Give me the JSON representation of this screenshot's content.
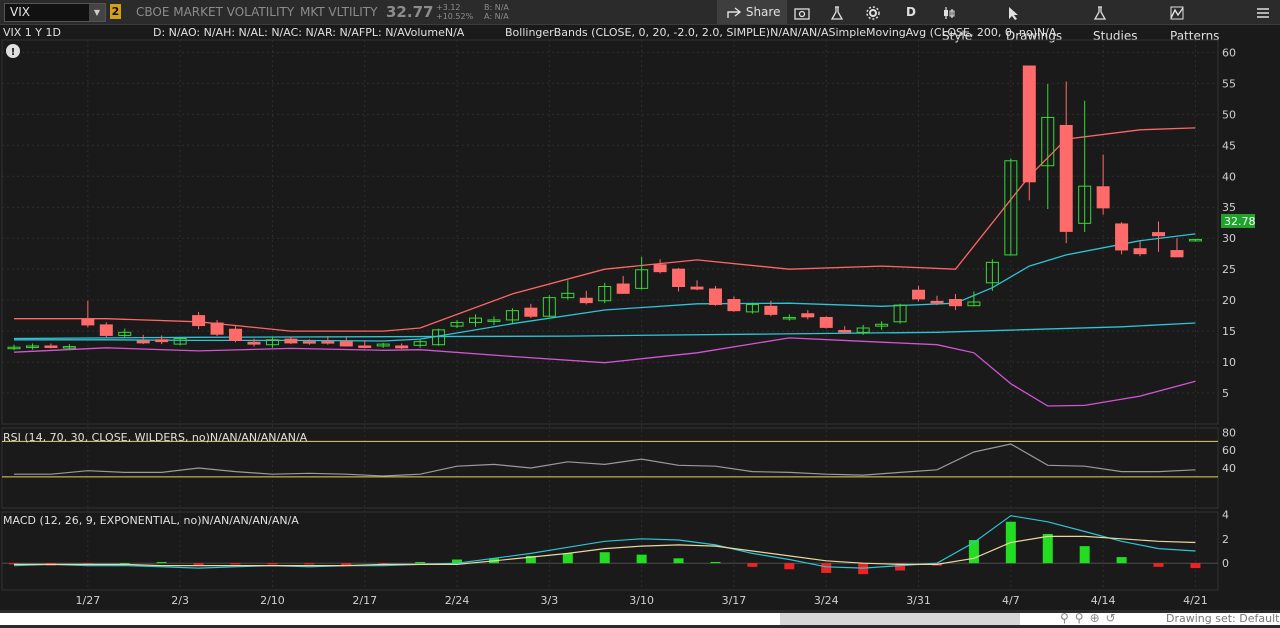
{
  "toolbar": {
    "symbol": "VIX",
    "badge": "2",
    "name": "CBOE MARKET VOLATILITY",
    "exchange": "MKT VLTILITY",
    "price": "32.77",
    "change": "+3.12",
    "change_pct": "+10.52%",
    "bid": "B: N/A",
    "ask": "A: N/A",
    "share_label": "Share",
    "period_label": "D",
    "style_label": "Style",
    "drawings_label": "Drawings",
    "studies_label": "Studies",
    "patterns_label": "Patterns"
  },
  "header": {
    "chart_label": "VIX 1 Y 1D",
    "quote_info": "D: N/AO: N/AH: N/AL: N/AC: N/AR: N/AFPL: N/AVolumeN/A",
    "studies_info": "BollingerBands (CLOSE, 0, 20, -2.0, 2.0, SIMPLE)N/AN/AN/ASimpleMovingAvg (CLOSE, 200, 0, no)N/A"
  },
  "rsi": {
    "label": "RSI (14, 70, 30, CLOSE, WILDERS, no)N/AN/AN/AN/AN/A"
  },
  "macd": {
    "label": "MACD (12, 26, 9, EXPONENTIAL, no)N/AN/AN/AN/AN/A"
  },
  "footer": {
    "drawing_set": "Drawing set: Default"
  },
  "colors": {
    "up": "#3ad63a",
    "down": "#ff6b6b",
    "upper_band": "#ff6666",
    "lower_band": "#d455d4",
    "sma": "#2ec4d6",
    "last_price": "#1fa32a"
  },
  "chart_data": [
    {
      "type": "candlestick",
      "panel": "price",
      "x_ticks": [
        "1/27",
        "2/3",
        "2/10",
        "2/17",
        "2/24",
        "3/3",
        "3/10",
        "3/17",
        "3/24",
        "3/31",
        "4/7",
        "4/14",
        "4/21"
      ],
      "x_tick_index": [
        4,
        9,
        14,
        19,
        24,
        29,
        34,
        39,
        44,
        49,
        54,
        59,
        64
      ],
      "y_ticks": [
        5,
        10,
        15,
        20,
        25,
        30,
        35,
        40,
        45,
        50,
        55,
        60
      ],
      "ylim": [
        0,
        62
      ],
      "last_price_label": "32.78",
      "candles": [
        {
          "o": 12.3,
          "h": 12.8,
          "l": 11.9,
          "c": 12.4
        },
        {
          "o": 12.5,
          "h": 13.0,
          "l": 12.0,
          "c": 12.6
        },
        {
          "o": 12.6,
          "h": 13.0,
          "l": 12.2,
          "c": 12.4
        },
        {
          "o": 12.4,
          "h": 12.9,
          "l": 12.1,
          "c": 12.5
        },
        {
          "o": 16.9,
          "h": 19.9,
          "l": 15.6,
          "c": 16.0
        },
        {
          "o": 16.0,
          "h": 16.4,
          "l": 14.0,
          "c": 14.3
        },
        {
          "o": 14.3,
          "h": 15.4,
          "l": 13.8,
          "c": 14.8
        },
        {
          "o": 13.4,
          "h": 14.4,
          "l": 12.9,
          "c": 13.1
        },
        {
          "o": 13.6,
          "h": 14.3,
          "l": 12.9,
          "c": 13.3
        },
        {
          "o": 12.9,
          "h": 14.0,
          "l": 12.7,
          "c": 13.8
        },
        {
          "o": 17.5,
          "h": 18.1,
          "l": 15.3,
          "c": 15.9
        },
        {
          "o": 16.3,
          "h": 16.8,
          "l": 14.2,
          "c": 14.5
        },
        {
          "o": 15.3,
          "h": 15.8,
          "l": 13.2,
          "c": 13.5
        },
        {
          "o": 13.2,
          "h": 13.8,
          "l": 12.5,
          "c": 12.9
        },
        {
          "o": 12.8,
          "h": 14.0,
          "l": 12.3,
          "c": 13.6
        },
        {
          "o": 13.7,
          "h": 14.1,
          "l": 12.9,
          "c": 13.1
        },
        {
          "o": 13.3,
          "h": 13.7,
          "l": 12.8,
          "c": 13.1
        },
        {
          "o": 13.3,
          "h": 14.2,
          "l": 12.8,
          "c": 13.2
        },
        {
          "o": 13.3,
          "h": 14.0,
          "l": 12.5,
          "c": 12.6
        },
        {
          "o": 12.6,
          "h": 13.5,
          "l": 12.2,
          "c": 12.4
        },
        {
          "o": 12.6,
          "h": 13.1,
          "l": 12.3,
          "c": 12.9
        },
        {
          "o": 12.6,
          "h": 13.0,
          "l": 12.1,
          "c": 12.3
        },
        {
          "o": 12.7,
          "h": 13.6,
          "l": 12.3,
          "c": 13.3
        },
        {
          "o": 12.8,
          "h": 15.4,
          "l": 12.6,
          "c": 15.2
        },
        {
          "o": 15.8,
          "h": 16.8,
          "l": 15.5,
          "c": 16.4
        },
        {
          "o": 16.4,
          "h": 17.7,
          "l": 15.7,
          "c": 17.1
        },
        {
          "o": 16.7,
          "h": 17.4,
          "l": 16.0,
          "c": 16.8
        },
        {
          "o": 16.8,
          "h": 18.7,
          "l": 16.3,
          "c": 18.3
        },
        {
          "o": 18.7,
          "h": 19.4,
          "l": 17.1,
          "c": 17.4
        },
        {
          "o": 17.4,
          "h": 20.8,
          "l": 17.3,
          "c": 20.4
        },
        {
          "o": 20.4,
          "h": 23.2,
          "l": 20.1,
          "c": 21.1
        },
        {
          "o": 20.3,
          "h": 21.5,
          "l": 19.3,
          "c": 19.6
        },
        {
          "o": 19.9,
          "h": 22.8,
          "l": 19.5,
          "c": 22.2
        },
        {
          "o": 22.6,
          "h": 23.9,
          "l": 21.0,
          "c": 21.1
        },
        {
          "o": 21.9,
          "h": 27.0,
          "l": 21.7,
          "c": 24.9
        },
        {
          "o": 25.7,
          "h": 26.6,
          "l": 24.3,
          "c": 24.6
        },
        {
          "o": 25.0,
          "h": 25.2,
          "l": 21.4,
          "c": 22.2
        },
        {
          "o": 22.1,
          "h": 23.2,
          "l": 21.6,
          "c": 21.8
        },
        {
          "o": 21.8,
          "h": 22.3,
          "l": 19.1,
          "c": 19.3
        },
        {
          "o": 20.1,
          "h": 20.6,
          "l": 18.1,
          "c": 18.3
        },
        {
          "o": 18.1,
          "h": 19.6,
          "l": 17.8,
          "c": 19.3
        },
        {
          "o": 19.0,
          "h": 19.9,
          "l": 17.4,
          "c": 17.7
        },
        {
          "o": 17.2,
          "h": 17.7,
          "l": 16.7,
          "c": 17.2
        },
        {
          "o": 17.8,
          "h": 18.4,
          "l": 16.9,
          "c": 17.3
        },
        {
          "o": 17.2,
          "h": 17.4,
          "l": 15.4,
          "c": 15.6
        },
        {
          "o": 15.1,
          "h": 15.8,
          "l": 14.7,
          "c": 15.0
        },
        {
          "o": 14.8,
          "h": 16.0,
          "l": 14.4,
          "c": 15.5
        },
        {
          "o": 15.8,
          "h": 16.6,
          "l": 15.2,
          "c": 16.1
        },
        {
          "o": 16.5,
          "h": 19.4,
          "l": 16.2,
          "c": 19.2
        },
        {
          "o": 21.6,
          "h": 22.3,
          "l": 19.8,
          "c": 20.2
        },
        {
          "o": 19.8,
          "h": 20.7,
          "l": 19.2,
          "c": 19.6
        },
        {
          "o": 20.1,
          "h": 21.0,
          "l": 18.4,
          "c": 19.1
        },
        {
          "o": 19.1,
          "h": 21.4,
          "l": 19.0,
          "c": 19.7
        },
        {
          "o": 22.8,
          "h": 26.6,
          "l": 21.5,
          "c": 26.1
        },
        {
          "o": 27.3,
          "h": 42.9,
          "l": 27.2,
          "c": 42.5
        },
        {
          "o": 57.8,
          "h": 57.8,
          "l": 36.1,
          "c": 39.1
        },
        {
          "o": 41.7,
          "h": 54.9,
          "l": 34.7,
          "c": 49.5
        },
        {
          "o": 48.2,
          "h": 55.3,
          "l": 29.2,
          "c": 31.1
        },
        {
          "o": 32.4,
          "h": 52.2,
          "l": 31.0,
          "c": 38.4
        },
        {
          "o": 38.3,
          "h": 43.5,
          "l": 33.8,
          "c": 34.9
        },
        {
          "o": 32.3,
          "h": 32.6,
          "l": 27.4,
          "c": 28.1
        },
        {
          "o": 28.3,
          "h": 29.5,
          "l": 27.1,
          "c": 27.5
        },
        {
          "o": 30.9,
          "h": 32.7,
          "l": 27.8,
          "c": 30.4
        },
        {
          "o": 28.0,
          "h": 30.0,
          "l": 27.0,
          "c": 27.0
        },
        {
          "o": 29.6,
          "h": 29.9,
          "l": 29.5,
          "c": 29.8
        }
      ],
      "overlays": [
        {
          "name": "upper_band",
          "x": [
            0,
            5,
            10,
            15,
            20,
            22,
            27,
            32,
            37,
            42,
            47,
            51,
            55,
            57,
            61,
            64
          ],
          "y": [
            17,
            17,
            16.5,
            15,
            15,
            15.5,
            21,
            25,
            26.5,
            25,
            25.5,
            25,
            40,
            46,
            47.5,
            47.8
          ]
        },
        {
          "name": "sma",
          "x": [
            0,
            10,
            20,
            30,
            40,
            50,
            60,
            64
          ],
          "y": [
            13.8,
            14.0,
            14.1,
            14.2,
            14.5,
            14.8,
            15.7,
            16.3
          ]
        },
        {
          "name": "middle_band",
          "x": [
            0,
            5,
            10,
            15,
            20,
            22,
            27,
            32,
            37,
            42,
            47,
            51,
            53,
            55,
            57,
            61,
            64
          ],
          "y": [
            13.6,
            13.6,
            13.5,
            13.5,
            13.4,
            13.7,
            16.2,
            18.4,
            19.4,
            19.5,
            19.0,
            19.5,
            22,
            25.5,
            27.3,
            29.6,
            30.7
          ]
        },
        {
          "name": "lower_band",
          "x": [
            0,
            5,
            10,
            15,
            20,
            22,
            27,
            32,
            37,
            42,
            47,
            50,
            52,
            54,
            56,
            58,
            61,
            64
          ],
          "y": [
            11.6,
            12.3,
            11.8,
            12.2,
            11.9,
            12.0,
            10.9,
            9.9,
            11.5,
            13.9,
            13.2,
            12.8,
            11.5,
            6.5,
            2.9,
            3.0,
            4.5,
            6.9
          ]
        }
      ]
    },
    {
      "type": "line",
      "panel": "rsi",
      "y_ticks": [
        40,
        60,
        80
      ],
      "ylim": [
        -5,
        85
      ],
      "overbought": 70,
      "oversold": 30,
      "x": [
        0,
        2,
        4,
        6,
        8,
        10,
        12,
        14,
        16,
        18,
        20,
        22,
        24,
        26,
        28,
        30,
        32,
        34,
        36,
        38,
        40,
        42,
        44,
        46,
        48,
        50,
        52,
        54,
        56,
        58,
        60,
        62,
        64
      ],
      "y": [
        33,
        33,
        37,
        35,
        35,
        40,
        36,
        33,
        34,
        33,
        31,
        33,
        42,
        44,
        40,
        47,
        44,
        50,
        43,
        42,
        36,
        35,
        33,
        32,
        35,
        38,
        58,
        67,
        43,
        42,
        36,
        36,
        38
      ]
    },
    {
      "type": "bar",
      "panel": "macd",
      "y_ticks": [
        0,
        2,
        4
      ],
      "ylim": [
        -2.2,
        4.2
      ],
      "x": [
        0,
        2,
        4,
        6,
        8,
        10,
        12,
        14,
        16,
        18,
        20,
        22,
        24,
        26,
        28,
        30,
        32,
        34,
        36,
        38,
        40,
        42,
        44,
        46,
        48,
        50,
        52,
        54,
        56,
        58,
        60,
        62,
        64
      ],
      "histogram": [
        -0.1,
        -0.2,
        -0.1,
        0,
        0.1,
        -0.2,
        -0.1,
        -0.1,
        -0.1,
        -0.2,
        -0.1,
        0.1,
        0.3,
        0.4,
        0.6,
        0.8,
        0.9,
        0.7,
        0.4,
        0.1,
        -0.3,
        -0.5,
        -0.8,
        -0.9,
        -0.6,
        -0.2,
        1.9,
        3.4,
        2.4,
        1.4,
        0.5,
        -0.3,
        -0.4
      ],
      "macd_line": [
        -0.2,
        -0.1,
        -0.2,
        -0.2,
        -0.3,
        -0.4,
        -0.3,
        -0.2,
        -0.3,
        -0.2,
        -0.2,
        -0.1,
        0,
        0.4,
        0.8,
        1.3,
        1.8,
        2.0,
        1.9,
        1.5,
        0.8,
        0.3,
        -0.3,
        -0.4,
        -0.2,
        0.0,
        1.7,
        3.9,
        3.4,
        2.6,
        1.8,
        1.2,
        1.0
      ],
      "signal_line": [
        -0.1,
        -0.1,
        -0.1,
        -0.1,
        -0.2,
        -0.2,
        -0.2,
        -0.2,
        -0.2,
        -0.2,
        -0.1,
        -0.1,
        -0.1,
        0.2,
        0.5,
        0.8,
        1.2,
        1.4,
        1.5,
        1.4,
        1.0,
        0.6,
        0.2,
        0,
        -0.1,
        -0.1,
        0.4,
        1.7,
        2.2,
        2.2,
        2.0,
        1.8,
        1.7
      ]
    }
  ]
}
